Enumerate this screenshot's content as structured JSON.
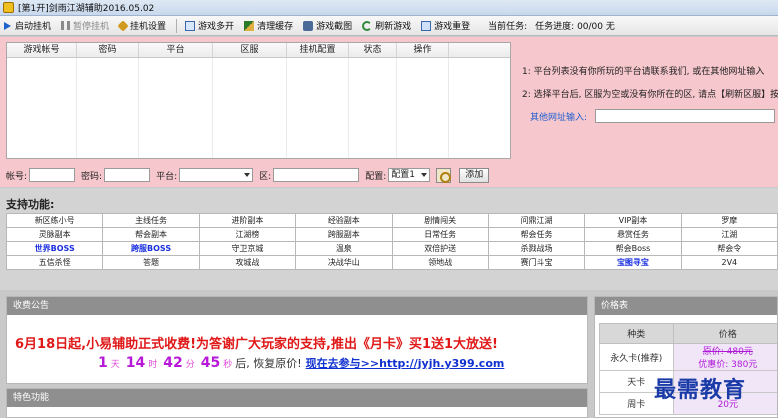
{
  "window": {
    "title": "[第1开]剑雨江湖辅助2016.05.02"
  },
  "toolbar": {
    "start": "启动挂机",
    "pause": "暂停挂机",
    "settings": "挂机设置",
    "multi": "游戏多开",
    "clear_cache": "清理缓存",
    "screenshot": "游戏截图",
    "refresh": "刷新游戏",
    "restart": "游戏重登",
    "task_label": "当前任务:",
    "progress_label": "任务进度: 00/00 无"
  },
  "grid": {
    "columns": [
      "游戏帐号",
      "密码",
      "平台",
      "区服",
      "挂机配置",
      "状态",
      "操作"
    ]
  },
  "form": {
    "account_label": "帐号:",
    "password_label": "密码:",
    "platform_label": "平台:",
    "server_label": "区:",
    "config_label": "配置:",
    "config_value": "配置1",
    "add_button": "添加"
  },
  "tips": {
    "tip1": "1: 平台列表没有你所玩的平台请联系我们, 或在其他网址输入",
    "tip2": "2: 选择平台后, 区服为空或没有你所在的区, 请点【刷新区服】按",
    "other_url_label": "其他网址输入:"
  },
  "support": {
    "title": "支持功能:",
    "rows": [
      [
        "新区练小号",
        "主线任务",
        "进阶副本",
        "经验副本",
        "剧情闯关",
        "问鼎江湖",
        "VIP副本",
        "罗摩"
      ],
      [
        "灵脉副本",
        "帮会副本",
        "江湖榜",
        "跨服副本",
        "日常任务",
        "帮会任务",
        "悬赏任务",
        "江湖"
      ],
      [
        "世界BOSS",
        "跨服BOSS",
        "守卫京城",
        "温泉",
        "双倍护送",
        "杀戮战场",
        "帮会Boss",
        "帮会令"
      ],
      [
        "五信杀怪",
        "答题",
        "攻城战",
        "决战华山",
        "领地战",
        "赛门斗宝",
        "宝图寻宝",
        "2V4"
      ]
    ]
  },
  "notice": {
    "header": "收费公告",
    "main": "6月18日起,小易辅助正式收费!为答谢广大玩家的支持,推出《月卡》买1送1大放送!",
    "days": "1",
    "days_unit": "天",
    "hours": "14",
    "hours_unit": "时",
    "minutes": "42",
    "minutes_unit": "分",
    "seconds": "45",
    "seconds_unit": "秒",
    "after": "后, 恢复原价!",
    "link": "现在去参与>>http://jyjh.y399.com"
  },
  "feature": {
    "header": "特色功能"
  },
  "price": {
    "header": "价格表",
    "col_type": "种类",
    "col_price": "价格",
    "rows": [
      {
        "type": "永久卡(推荐)",
        "orig": "原价: 480元",
        "sale": "优惠价: 380元"
      },
      {
        "type": "天卡",
        "orig": "",
        "sale": ""
      },
      {
        "type": "周卡",
        "orig": "",
        "sale": "20元"
      }
    ]
  },
  "watermark": "最需教育"
}
